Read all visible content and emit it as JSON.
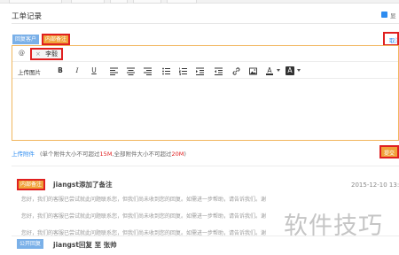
{
  "section_title": "工单记录",
  "header_checkbox_label": "显",
  "reply_tags": {
    "reply": "回复客户",
    "note": "内部备注"
  },
  "cancel_label": "取消",
  "mention": {
    "at_symbol": "@",
    "remove_glyph": "×",
    "name": "李毅"
  },
  "toolbar": {
    "upload_image": "上传图片",
    "tools": [
      "bold-icon",
      "italic-icon",
      "underline-icon",
      "align-left-icon",
      "align-center-icon",
      "align-right-icon",
      "bulleted-list-icon",
      "numbered-list-icon",
      "indent-icon",
      "link-icon",
      "image-icon",
      "font-color-icon",
      "highlight-color-icon"
    ],
    "bold": "B",
    "italic": "I",
    "underline": "U",
    "font_color": "A",
    "highlight": "A"
  },
  "upload": {
    "link": "上传附件",
    "hint_prefix": "(单个附件大小不可超过",
    "limit_single": "15M",
    "hint_middle": ",全部附件大小不可超过",
    "limit_total": "20M",
    "hint_suffix": ")"
  },
  "save_label": "提交",
  "entries": [
    {
      "tag": "内部备注",
      "title": "jiangst添加了备注",
      "time": "2015-12-10 13:5",
      "lines": [
        "您好，我们的客服已尝试就此问题联系您，但我们尚未收到您的回复。如需进一步帮助，请告诉我们。谢",
        "您好，我们的客服已尝试就此问题联系您，但我们尚未收到您的回复。如需进一步帮助，请告诉我们。谢",
        "您好，我们的客服已尝试就此问题联系您，但我们尚未收到您的回复。如需进一步帮助，请告诉我们。谢"
      ]
    },
    {
      "tag": "公开回复",
      "title": "jiangst回复 至 张帅"
    }
  ],
  "watermark": "软件技巧",
  "colors": {
    "accent_blue": "#2d8cf0",
    "orange": "#f0a23a",
    "highlight_red": "#e02020",
    "tag_blue": "#7ab0e8"
  }
}
